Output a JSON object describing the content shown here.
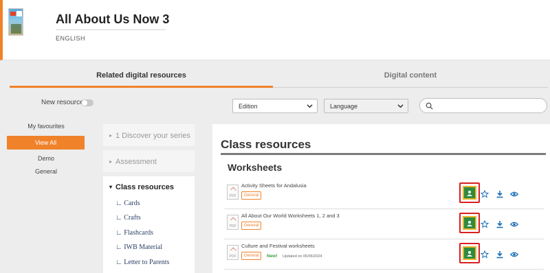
{
  "header": {
    "title": "All About Us Now 3",
    "subtitle": "ENGLISH"
  },
  "tabs": {
    "related": "Related digital resources",
    "digital": "Digital content"
  },
  "filters": {
    "new_resources_label": "New resources",
    "edition": "Edition",
    "language": "Language",
    "search_placeholder": ""
  },
  "left_nav": {
    "favourites": "My favourites",
    "view_all": "View All",
    "demo": "Demo",
    "general": "General"
  },
  "accordion": {
    "discover": "1 Discover your series",
    "assessment": "Assessment",
    "class_resources": "Class resources",
    "subitems": [
      "Cards",
      "Crafts",
      "Flashcards",
      "IWB Material",
      "Letter to Parents"
    ]
  },
  "panel": {
    "title": "Class resources",
    "section": "Worksheets",
    "rows": [
      {
        "title": "Activity Sheets for Andalusia",
        "badge": "General",
        "new": "",
        "updated": ""
      },
      {
        "title": "All About Our World Worksheets 1, 2 and 3",
        "badge": "General",
        "new": "",
        "updated": ""
      },
      {
        "title": "Culture and Festival worksheets",
        "badge": "General",
        "new": "New!",
        "updated": "Updated on 05/06/2024"
      }
    ],
    "file_type": "PDF"
  },
  "colors": {
    "accent": "#f0822a",
    "link": "#1a6fb5",
    "classroom_green": "#2e8b3f",
    "highlight_red": "#d81f1f"
  },
  "icons": [
    "google-classroom-icon",
    "star-icon",
    "download-icon",
    "eye-icon",
    "search-icon",
    "chevron-down-icon"
  ]
}
